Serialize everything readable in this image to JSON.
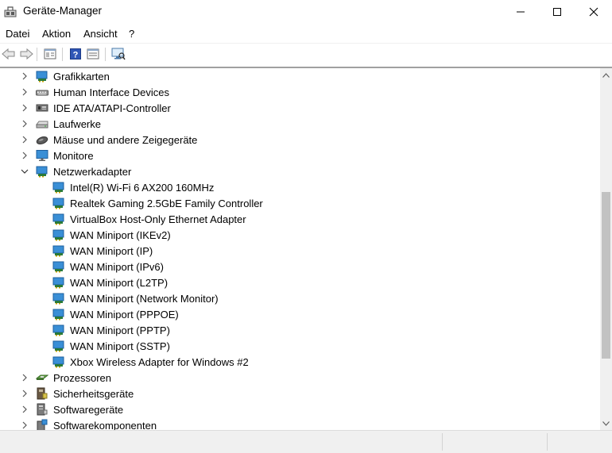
{
  "window": {
    "title": "Geräte-Manager"
  },
  "menu": [
    "Datei",
    "Aktion",
    "Ansicht",
    "?"
  ],
  "tree": [
    {
      "label": "Grafikkarten",
      "level": 0,
      "expanded": false,
      "icon": "display-adapter-icon"
    },
    {
      "label": "Human Interface Devices",
      "level": 0,
      "expanded": false,
      "icon": "hid-icon"
    },
    {
      "label": "IDE ATA/ATAPI-Controller",
      "level": 0,
      "expanded": false,
      "icon": "ide-controller-icon"
    },
    {
      "label": "Laufwerke",
      "level": 0,
      "expanded": false,
      "icon": "disk-drive-icon"
    },
    {
      "label": "Mäuse und andere Zeigegeräte",
      "level": 0,
      "expanded": false,
      "icon": "mouse-icon"
    },
    {
      "label": "Monitore",
      "level": 0,
      "expanded": false,
      "icon": "monitor-icon"
    },
    {
      "label": "Netzwerkadapter",
      "level": 0,
      "expanded": true,
      "icon": "network-adapter-icon"
    },
    {
      "label": "Intel(R) Wi-Fi 6 AX200 160MHz",
      "level": 1,
      "icon": "network-adapter-icon"
    },
    {
      "label": "Realtek Gaming 2.5GbE Family Controller",
      "level": 1,
      "icon": "network-adapter-icon"
    },
    {
      "label": "VirtualBox Host-Only Ethernet Adapter",
      "level": 1,
      "icon": "network-adapter-icon"
    },
    {
      "label": "WAN Miniport (IKEv2)",
      "level": 1,
      "icon": "network-adapter-icon"
    },
    {
      "label": "WAN Miniport (IP)",
      "level": 1,
      "icon": "network-adapter-icon"
    },
    {
      "label": "WAN Miniport (IPv6)",
      "level": 1,
      "icon": "network-adapter-icon"
    },
    {
      "label": "WAN Miniport (L2TP)",
      "level": 1,
      "icon": "network-adapter-icon"
    },
    {
      "label": "WAN Miniport (Network Monitor)",
      "level": 1,
      "icon": "network-adapter-icon"
    },
    {
      "label": "WAN Miniport (PPPOE)",
      "level": 1,
      "icon": "network-adapter-icon"
    },
    {
      "label": "WAN Miniport (PPTP)",
      "level": 1,
      "icon": "network-adapter-icon"
    },
    {
      "label": "WAN Miniport (SSTP)",
      "level": 1,
      "icon": "network-adapter-icon"
    },
    {
      "label": "Xbox Wireless Adapter for Windows #2",
      "level": 1,
      "icon": "network-adapter-icon"
    },
    {
      "label": "Prozessoren",
      "level": 0,
      "expanded": false,
      "icon": "processor-icon"
    },
    {
      "label": "Sicherheitsgeräte",
      "level": 0,
      "expanded": false,
      "icon": "security-device-icon"
    },
    {
      "label": "Softwaregeräte",
      "level": 0,
      "expanded": false,
      "icon": "software-device-icon"
    },
    {
      "label": "Softwarekomponenten",
      "level": 0,
      "expanded": false,
      "icon": "software-component-icon"
    }
  ],
  "colors": {
    "network_blue": "#3a8fd6",
    "scroll_thumb": "#c2c2c2",
    "statusbar": "#f0f0f0"
  }
}
